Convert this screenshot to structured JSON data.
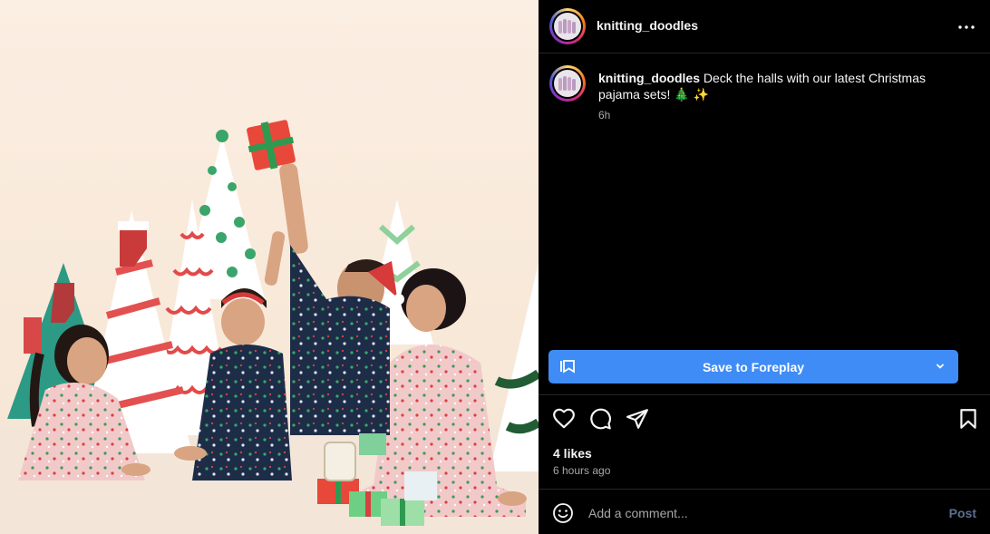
{
  "post": {
    "username": "knitting_doodles",
    "caption": "Deck the halls with our latest Christmas pajama sets! 🎄 ✨",
    "caption_time": "6h",
    "likes": "4 likes",
    "time_ago": "6 hours ago",
    "image_alt": "Family in Christmas pajamas posing with paper trees and gifts"
  },
  "save": {
    "label": "Save to Foreplay"
  },
  "comment": {
    "placeholder": "Add a comment...",
    "post_label": "Post"
  },
  "icons": {
    "more": "more-horizontal-icon",
    "like": "heart-icon",
    "comment": "comment-icon",
    "share": "share-icon",
    "bookmark": "bookmark-icon",
    "emoji": "emoji-icon",
    "save": "foreplay-icon",
    "chevron": "chevron-down-icon"
  },
  "colors": {
    "save_button": "#3f8cf7",
    "post_button": "#5b6f8f",
    "background": "#000000"
  }
}
